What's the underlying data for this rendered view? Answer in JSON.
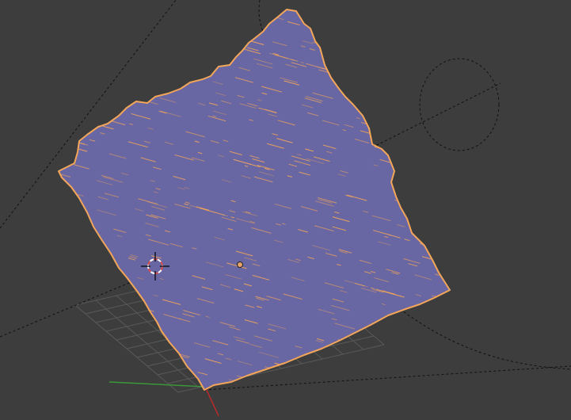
{
  "viewport": {
    "background": "#3d3d3d",
    "grid_color": "#595959",
    "axis_x_color": "#c22a2a",
    "axis_y_color": "#3a9a3a",
    "guide_color": "#111111"
  },
  "mesh": {
    "selected": true,
    "fill_color": "#6866a3",
    "edge_color": "#f3a65a",
    "origin_color": "#e6a36a"
  },
  "cursor": {
    "icon": "3d-cursor-icon",
    "ring_color_a": "#d84d4d",
    "ring_color_b": "#ffffff"
  }
}
